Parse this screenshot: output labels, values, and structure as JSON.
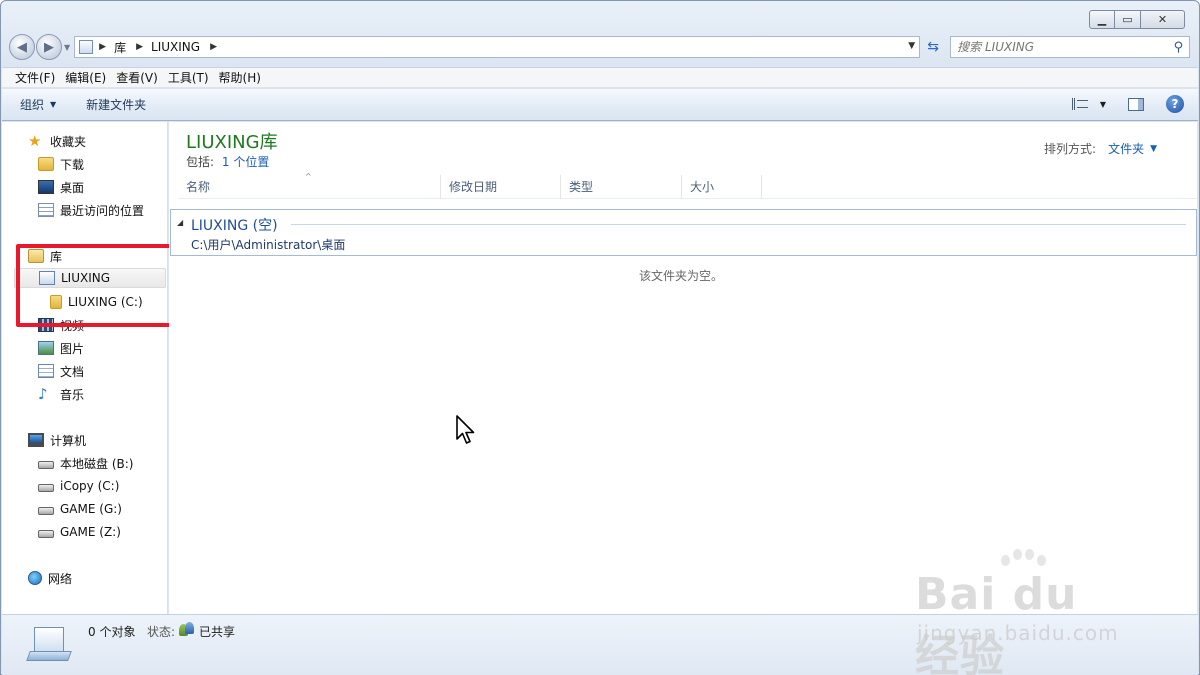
{
  "window": {
    "caption": {
      "minimize": "▁",
      "maximize": "▭",
      "close": "✕"
    }
  },
  "address_bar": {
    "breadcrumbs": [
      "库",
      "LIUXING"
    ],
    "search_placeholder": "搜索 LIUXING"
  },
  "menu": [
    "文件(F)",
    "编辑(E)",
    "查看(V)",
    "工具(T)",
    "帮助(H)"
  ],
  "toolbar": {
    "organize": "组织",
    "new_folder": "新建文件夹"
  },
  "nav_pane": {
    "favorites_header": "收藏夹",
    "favorites": [
      "下载",
      "桌面",
      "最近访问的位置"
    ],
    "libraries_header": "库",
    "libraries": [
      {
        "label": "LIUXING",
        "selected": true
      },
      {
        "label": "LIUXING (C:)",
        "child": true
      },
      {
        "label": "视频"
      },
      {
        "label": "图片"
      },
      {
        "label": "文档"
      },
      {
        "label": "音乐"
      }
    ],
    "computer_header": "计算机",
    "drives": [
      "本地磁盘 (B:)",
      "iCopy (C:)",
      "GAME (G:)",
      "GAME (Z:)"
    ],
    "network": "网络"
  },
  "content": {
    "library_title": "LIUXING库",
    "includes_label": "包括:",
    "includes_link": "1 个位置",
    "arrange_label": "排列方式:",
    "arrange_value": "文件夹",
    "columns": [
      "名称",
      "修改日期",
      "类型",
      "大小"
    ],
    "group": {
      "title": "LIUXING (空)",
      "path": "C:\\用户\\Administrator\\桌面"
    },
    "empty_message": "该文件夹为空。"
  },
  "status": {
    "count": "0 个对象",
    "state_label": "状态:",
    "state_value": "已共享"
  },
  "watermark": {
    "brand": "Bai du 经验",
    "url": "jingyan.baidu.com"
  },
  "colors": {
    "library_title": "#1e7a1e",
    "link": "#1a5fb4",
    "highlight_box": "#e8192c"
  }
}
